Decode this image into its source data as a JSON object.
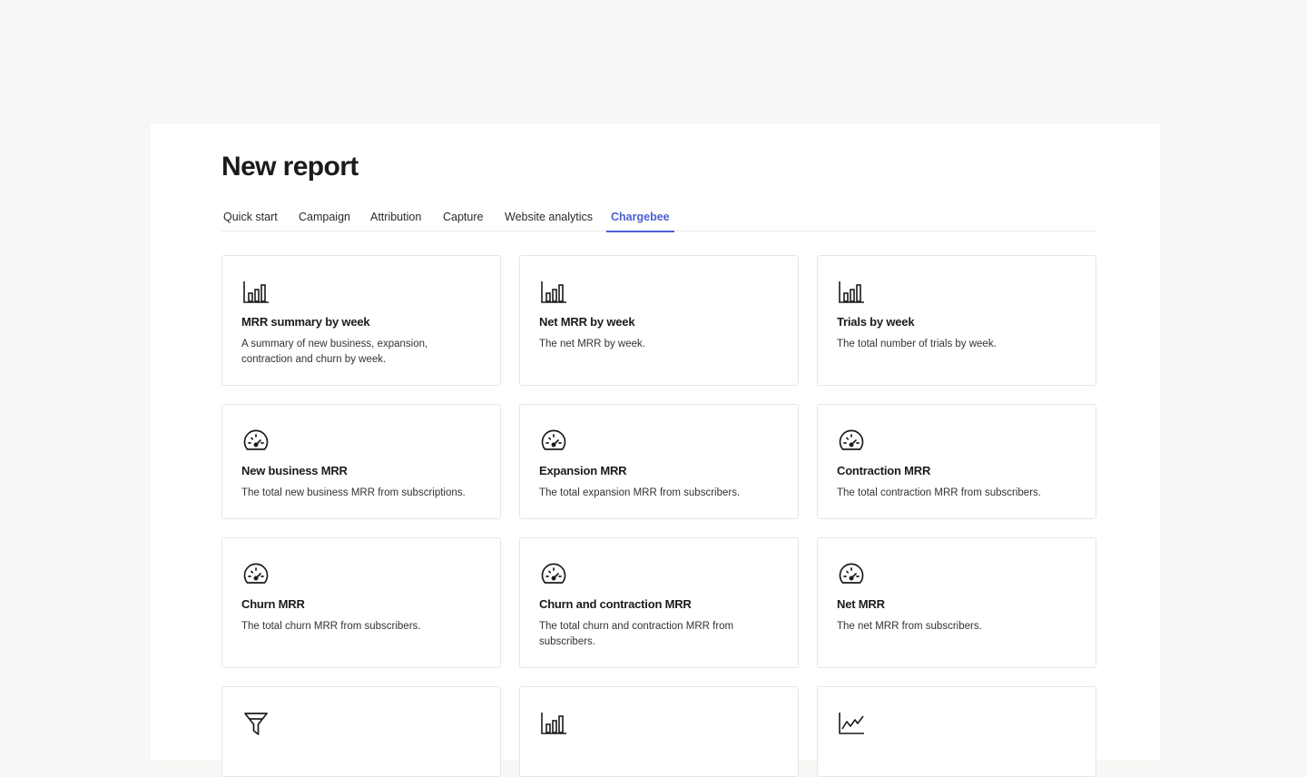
{
  "page": {
    "title": "New report"
  },
  "tabs": [
    {
      "label": "Quick start"
    },
    {
      "label": "Campaign"
    },
    {
      "label": "Attribution"
    },
    {
      "label": "Capture"
    },
    {
      "label": "Website analytics"
    },
    {
      "label": "Chargebee",
      "active": true
    }
  ],
  "colors": {
    "accent": "#4a5fd1"
  },
  "cards": [
    {
      "icon": "bar-chart-icon",
      "title": "MRR summary by week",
      "desc": "A summary of new business, expansion, contraction and churn by week."
    },
    {
      "icon": "bar-chart-icon",
      "title": "Net MRR by week",
      "desc": "The net MRR by week."
    },
    {
      "icon": "bar-chart-icon",
      "title": "Trials by week",
      "desc": "The total number of trials by week."
    },
    {
      "icon": "gauge-icon",
      "title": "New business MRR",
      "desc": "The total new business MRR from subscriptions."
    },
    {
      "icon": "gauge-icon",
      "title": "Expansion MRR",
      "desc": "The total expansion MRR from subscribers."
    },
    {
      "icon": "gauge-icon",
      "title": "Contraction MRR",
      "desc": "The total contraction MRR from subscribers."
    },
    {
      "icon": "gauge-icon",
      "title": "Churn MRR",
      "desc": "The total churn MRR from subscribers."
    },
    {
      "icon": "gauge-icon",
      "title": "Churn and contraction MRR",
      "desc": "The total churn and contraction MRR from subscribers."
    },
    {
      "icon": "gauge-icon",
      "title": "Net MRR",
      "desc": "The net MRR from subscribers."
    },
    {
      "icon": "funnel-icon",
      "title": "",
      "desc": ""
    },
    {
      "icon": "bar-chart-icon",
      "title": "",
      "desc": ""
    },
    {
      "icon": "line-chart-icon",
      "title": "",
      "desc": ""
    }
  ]
}
